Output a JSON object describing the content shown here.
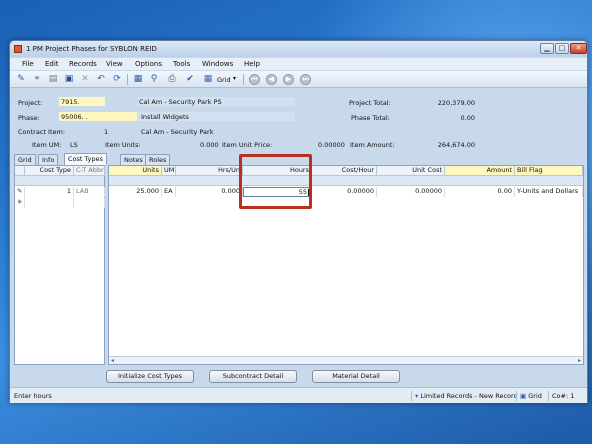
{
  "window": {
    "title": "1 PM Project Phases for SYBLON REID",
    "controls": {
      "minimize": "▁",
      "maximize": "□",
      "close": "✕"
    }
  },
  "menu": [
    "File",
    "Edit",
    "Records",
    "View",
    "Options",
    "Tools",
    "Windows",
    "Help"
  ],
  "toolbar": {
    "grid_label": "Grid",
    "icons": [
      "properties-icon",
      "link-icon",
      "database-icon",
      "save-icon",
      "delete-icon",
      "undo-icon",
      "refresh-icon",
      "calculator-icon",
      "attachment-icon",
      "print-icon",
      "spellcheck-icon",
      "grid-icon",
      "first-record-icon",
      "previous-record-icon",
      "next-record-icon",
      "last-record-icon"
    ]
  },
  "header": {
    "project_label": "Project:",
    "project_value": "7915.",
    "project_desc": "Cal Am - Security Park PS",
    "project_total_label": "Project Total:",
    "project_total_value": "220,379.00",
    "phase_label": "Phase:",
    "phase_value": "95006.  .",
    "phase_desc": "Install Widgets",
    "phase_total_label": "Phase Total:",
    "phase_total_value": "0.00",
    "contract_item_label": "Contract Item:",
    "contract_item_value": "1",
    "contract_item_desc": "Cal Am - Security Park",
    "item_um_label": "Item UM:",
    "item_um_value": "LS",
    "item_units_label": "Item Units:",
    "item_units_value": "0.000",
    "item_unit_price_label": "Item Unit Price:",
    "item_unit_price_value": "0.00000",
    "item_amount_label": "Item Amount:",
    "item_amount_value": "264,674.00"
  },
  "tabs_left": [
    {
      "label": "Grid",
      "active": false
    },
    {
      "label": "Info",
      "active": false
    },
    {
      "label": "Cost Types",
      "active": true
    }
  ],
  "tabs_right": [
    {
      "label": "Notes",
      "active": false
    },
    {
      "label": "Roles",
      "active": false
    }
  ],
  "left_grid": {
    "headers": [
      "Cost Type",
      "C-T Abbr"
    ],
    "rows": [
      {
        "cost_type": "1",
        "ct_abbr": "LAB"
      }
    ],
    "edit_marker": "✎",
    "new_marker": "✳"
  },
  "right_grid": {
    "headers": [
      "Units",
      "UM",
      "Hrs/Un",
      "Hours",
      "Cost/Hour",
      "Unit Cost",
      "Amount",
      "Bill Flag"
    ],
    "rows": [
      {
        "units": "25.000",
        "um": "EA",
        "hrs_un": "0.000",
        "hours": "55",
        "cost_hour": "0.00000",
        "unit_cost": "0.00000",
        "amount": "0.00",
        "bill_flag": "Y-Units and Dollars"
      }
    ]
  },
  "buttons": {
    "init_cost_types": "Initialize Cost Types",
    "subcontract_detail": "Subcontract Detail",
    "material_detail": "Material Detail"
  },
  "status": {
    "message": "Enter hours",
    "limited_records": "Limited Records - New Record",
    "grid": "Grid",
    "company": "Co#: 1"
  },
  "colors": {
    "highlight_border": "#b83020",
    "field_yellow": "#fff7c0",
    "window_bg": "#c9d9ec"
  }
}
